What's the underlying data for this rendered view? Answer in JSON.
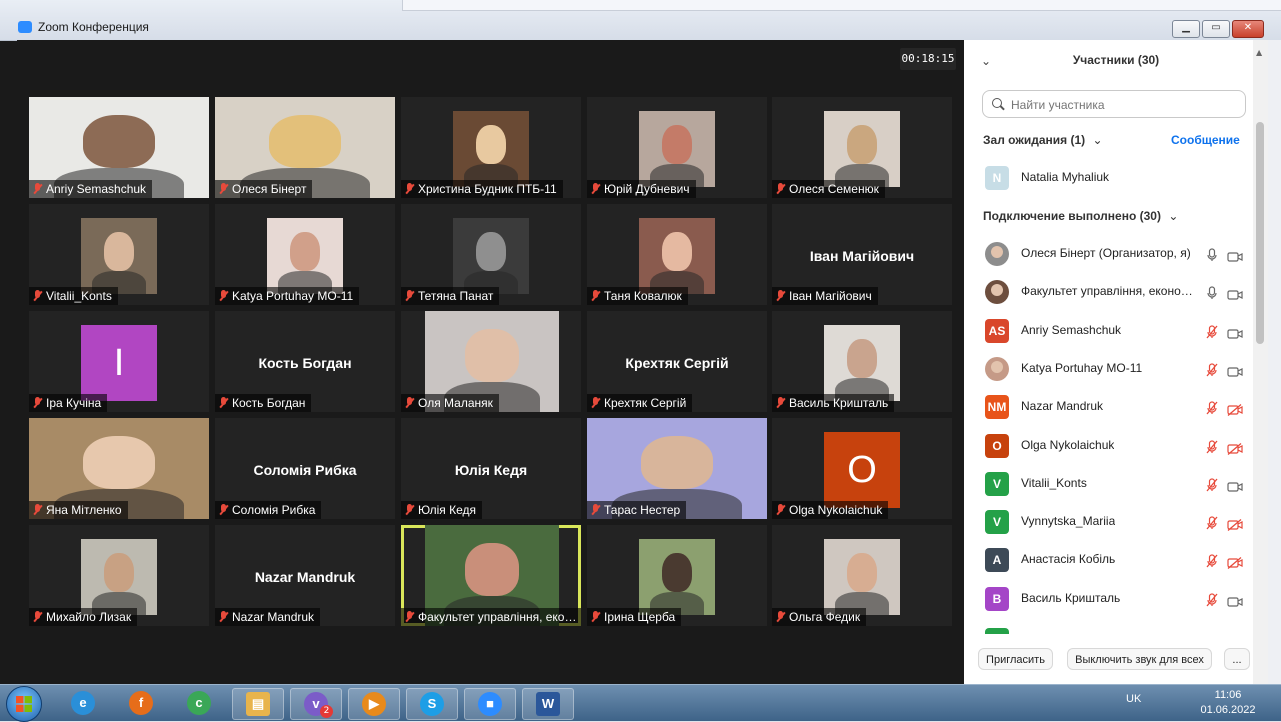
{
  "window": {
    "title": "Zoom Конференция",
    "timer": "00:18:15"
  },
  "tiles": [
    {
      "label": "Anriy Semashchuk",
      "mode": "video-full",
      "bg": "#e9e9e6",
      "fg": "#8d6b55"
    },
    {
      "label": "Олеся Бінерт",
      "mode": "video-full",
      "bg": "#d8d1c6",
      "fg": "#e3c07a"
    },
    {
      "label": "Христина Будник ПТБ-11",
      "mode": "video",
      "bg": "#6a4a34",
      "fg": "#e8c9a0"
    },
    {
      "label": "Юрій Дубневич",
      "mode": "video",
      "bg": "#b7a79d",
      "fg": "#c47b68"
    },
    {
      "label": "Олеся Семенюк",
      "mode": "video",
      "bg": "#d8cfc6",
      "fg": "#caa77f"
    },
    {
      "label": "Vitalii_Konts",
      "mode": "video",
      "bg": "#7a6a58",
      "fg": "#d9b79c"
    },
    {
      "label": "Katya Portuhay MO-11",
      "mode": "video",
      "bg": "#e7d9d4",
      "fg": "#d1a08a"
    },
    {
      "label": "Тетяна Панат",
      "mode": "video",
      "bg": "#3b3b3b",
      "fg": "#8f8f8f"
    },
    {
      "label": "Таня Ковалюк",
      "mode": "video",
      "bg": "#8a5b4e",
      "fg": "#e5b9a1"
    },
    {
      "label": "Іван Магійович",
      "mode": "name",
      "big": "Іван Магійович"
    },
    {
      "label": "Іра Кучіна",
      "mode": "avatar",
      "letter": "I",
      "color": "#b146c2"
    },
    {
      "label": "Кость Богдан",
      "mode": "name",
      "big": "Кость Богдан"
    },
    {
      "label": "Оля Маланяк",
      "mode": "video-mid",
      "bg": "#c9c4c2",
      "fg": "#e0bfa8"
    },
    {
      "label": "Крехтяк Сергій",
      "mode": "name",
      "big": "Крехтяк Сергій"
    },
    {
      "label": "Василь Кришталь",
      "mode": "video",
      "bg": "#dedad5",
      "fg": "#c9a48e"
    },
    {
      "label": "Яна Мітленко",
      "mode": "video-full",
      "bg": "#a88b66",
      "fg": "#e7c8ad"
    },
    {
      "label": "Соломія Рибка",
      "mode": "name",
      "big": "Соломія Рибка"
    },
    {
      "label": "Юлія Кедя",
      "mode": "name",
      "big": "Юлія Кедя"
    },
    {
      "label": "Тарас Нестер",
      "mode": "video-full",
      "bg": "#a7a6de",
      "fg": "#d8b59b"
    },
    {
      "label": "Olga Nykolaichuk",
      "mode": "avatar",
      "letter": "O",
      "color": "#c7420d"
    },
    {
      "label": "Михайло Лизак",
      "mode": "video",
      "bg": "#bdbab0",
      "fg": "#c8a183"
    },
    {
      "label": "Nazar Mandruk",
      "mode": "name",
      "big": "Nazar Mandruk"
    },
    {
      "label": "Факультет управління, економ...",
      "mode": "video-mid",
      "bg": "#4a6b3e",
      "fg": "#c98f7a",
      "active": true
    },
    {
      "label": "Ірина Щерба",
      "mode": "video",
      "bg": "#8ca06f",
      "fg": "#4a3a30"
    },
    {
      "label": "Ольга Федик",
      "mode": "video",
      "bg": "#cfc7c0",
      "fg": "#d7ad92"
    }
  ],
  "panel": {
    "title": "Участники (30)",
    "search_placeholder": "Найти участника",
    "waiting_title": "Зал ожидания (1)",
    "message_label": "Сообщение",
    "waiting": [
      {
        "name": "Natalia Myhaliuk",
        "initials": "N",
        "color": "#c7dde6"
      }
    ],
    "connected_title": "Подключение выполнено (30)",
    "participants": [
      {
        "name": "Олеся Бінерт (Организатор, я)",
        "initials": "",
        "color": "#8d8d8d",
        "mic": "on",
        "cam": "on"
      },
      {
        "name": "Факультет управління, економ...",
        "initials": "",
        "color": "#6d4e3e",
        "mic": "on",
        "cam": "on"
      },
      {
        "name": "Anriy Semashchuk",
        "initials": "AS",
        "color": "#d9472b",
        "mic": "off",
        "cam": "on"
      },
      {
        "name": "Katya Portuhay MO-11",
        "initials": "",
        "color": "#c59a87",
        "mic": "off",
        "cam": "on"
      },
      {
        "name": "Nazar Mandruk",
        "initials": "NM",
        "color": "#e8541a",
        "mic": "off",
        "cam": "off"
      },
      {
        "name": "Olga Nykolaichuk",
        "initials": "O",
        "color": "#c7420d",
        "mic": "off",
        "cam": "off"
      },
      {
        "name": "Vitalii_Konts",
        "initials": "V",
        "color": "#24a148",
        "mic": "off",
        "cam": "on"
      },
      {
        "name": "Vynnytska_Mariia",
        "initials": "V",
        "color": "#24a148",
        "mic": "off",
        "cam": "off"
      },
      {
        "name": "Анастасія Кобіль",
        "initials": "A",
        "color": "#3d4a57",
        "mic": "off",
        "cam": "off"
      },
      {
        "name": "Василь Кришталь",
        "initials": "B",
        "color": "#a445c7",
        "mic": "off",
        "cam": "on"
      }
    ],
    "invite_label": "Пригласить",
    "mute_all_label": "Выключить звук для всех",
    "more_label": "..."
  },
  "taskbar": {
    "apps": [
      {
        "name": "ie",
        "glyph": "e",
        "color": "#2a8fd8"
      },
      {
        "name": "firefox",
        "glyph": "f",
        "color": "#e66d1a"
      },
      {
        "name": "chrome",
        "glyph": "c",
        "color": "#3aa757"
      },
      {
        "name": "explorer",
        "glyph": "▤",
        "color": "#e8b44c"
      },
      {
        "name": "viber",
        "glyph": "v",
        "color": "#7b5cc8",
        "badge": "2"
      },
      {
        "name": "media",
        "glyph": "▶",
        "color": "#e88a1c"
      },
      {
        "name": "skype",
        "glyph": "S",
        "color": "#1d9ee6"
      },
      {
        "name": "zoom",
        "glyph": "■",
        "color": "#2d8cff"
      },
      {
        "name": "word",
        "glyph": "W",
        "color": "#2b579a"
      }
    ],
    "lang": "UK",
    "time": "11:06",
    "date": "01.06.2022"
  }
}
